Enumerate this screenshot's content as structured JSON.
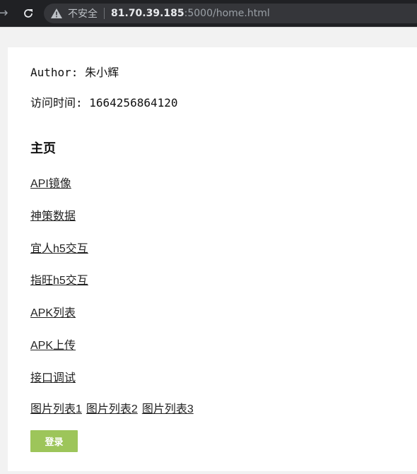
{
  "browser": {
    "security_label": "不安全",
    "url_host": "81.70.39.185",
    "url_rest": ":5000/home.html",
    "icons": [
      "back-arrow-icon",
      "reload-icon",
      "warning-icon"
    ]
  },
  "header": {
    "author": "Author: 朱小辉",
    "visit_time": "访问时间: 1664256864120"
  },
  "main": {
    "title": "主页",
    "links": [
      "API镜像",
      "神策数据",
      "宜人h5交互",
      "指旺h5交互",
      "APK列表",
      "APK上传",
      "接口调试"
    ],
    "image_links": [
      "图片列表1",
      "图片列表2",
      "图片列表3"
    ],
    "login_label": "登录"
  },
  "colors": {
    "login_button": "#9dc55a",
    "browser_bar": "#202124"
  }
}
